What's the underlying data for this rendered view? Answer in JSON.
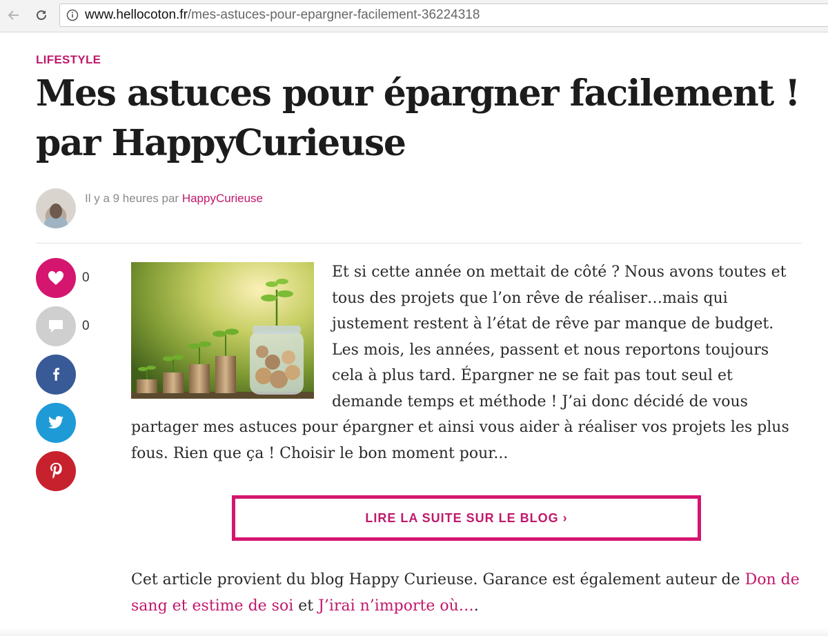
{
  "browser": {
    "url_host": "www.hellocoton.fr",
    "url_path": "/mes-astuces-pour-epargner-facilement-36224318"
  },
  "article": {
    "category": "LIFESTYLE",
    "title": "Mes astuces pour épargner facilement ! par HappyCurieuse",
    "meta_prefix": "Il y a 9 heures par",
    "author": "HappyCurieuse",
    "excerpt": "Et si cette année on mettait de côté ? Nous avons toutes et tous des projets que l’on rêve de réaliser…mais qui justement restent à l’état de rêve par manque de budget. Les mois, les années, passent et nous reportons toujours cela à plus tard. Épargner ne se fait pas tout seul et demande temps et méthode ! J’ai donc décidé de vous partager mes astuces pour épargner et ainsi vous aider à réaliser vos projets les plus fous. Rien que ça ! Choisir le bon moment pour...",
    "read_more_label": "LIRE LA SUITE SUR LE BLOG ›",
    "source_prefix": "Cet article provient du blog Happy Curieuse. Garance est également auteur de",
    "source_link1": "Don de sang et estime de soi",
    "source_middle": "et",
    "source_link2": "J’irai n’importe où…",
    "source_suffix": "."
  },
  "social": {
    "likes": "0",
    "comments": "0",
    "icons": [
      "heart-icon",
      "comment-icon",
      "facebook-icon",
      "twitter-icon",
      "pinterest-icon"
    ]
  },
  "colors": {
    "accent": "#d4166f",
    "facebook": "#385a97",
    "twitter": "#1e9bd7",
    "pinterest": "#c8212e"
  }
}
